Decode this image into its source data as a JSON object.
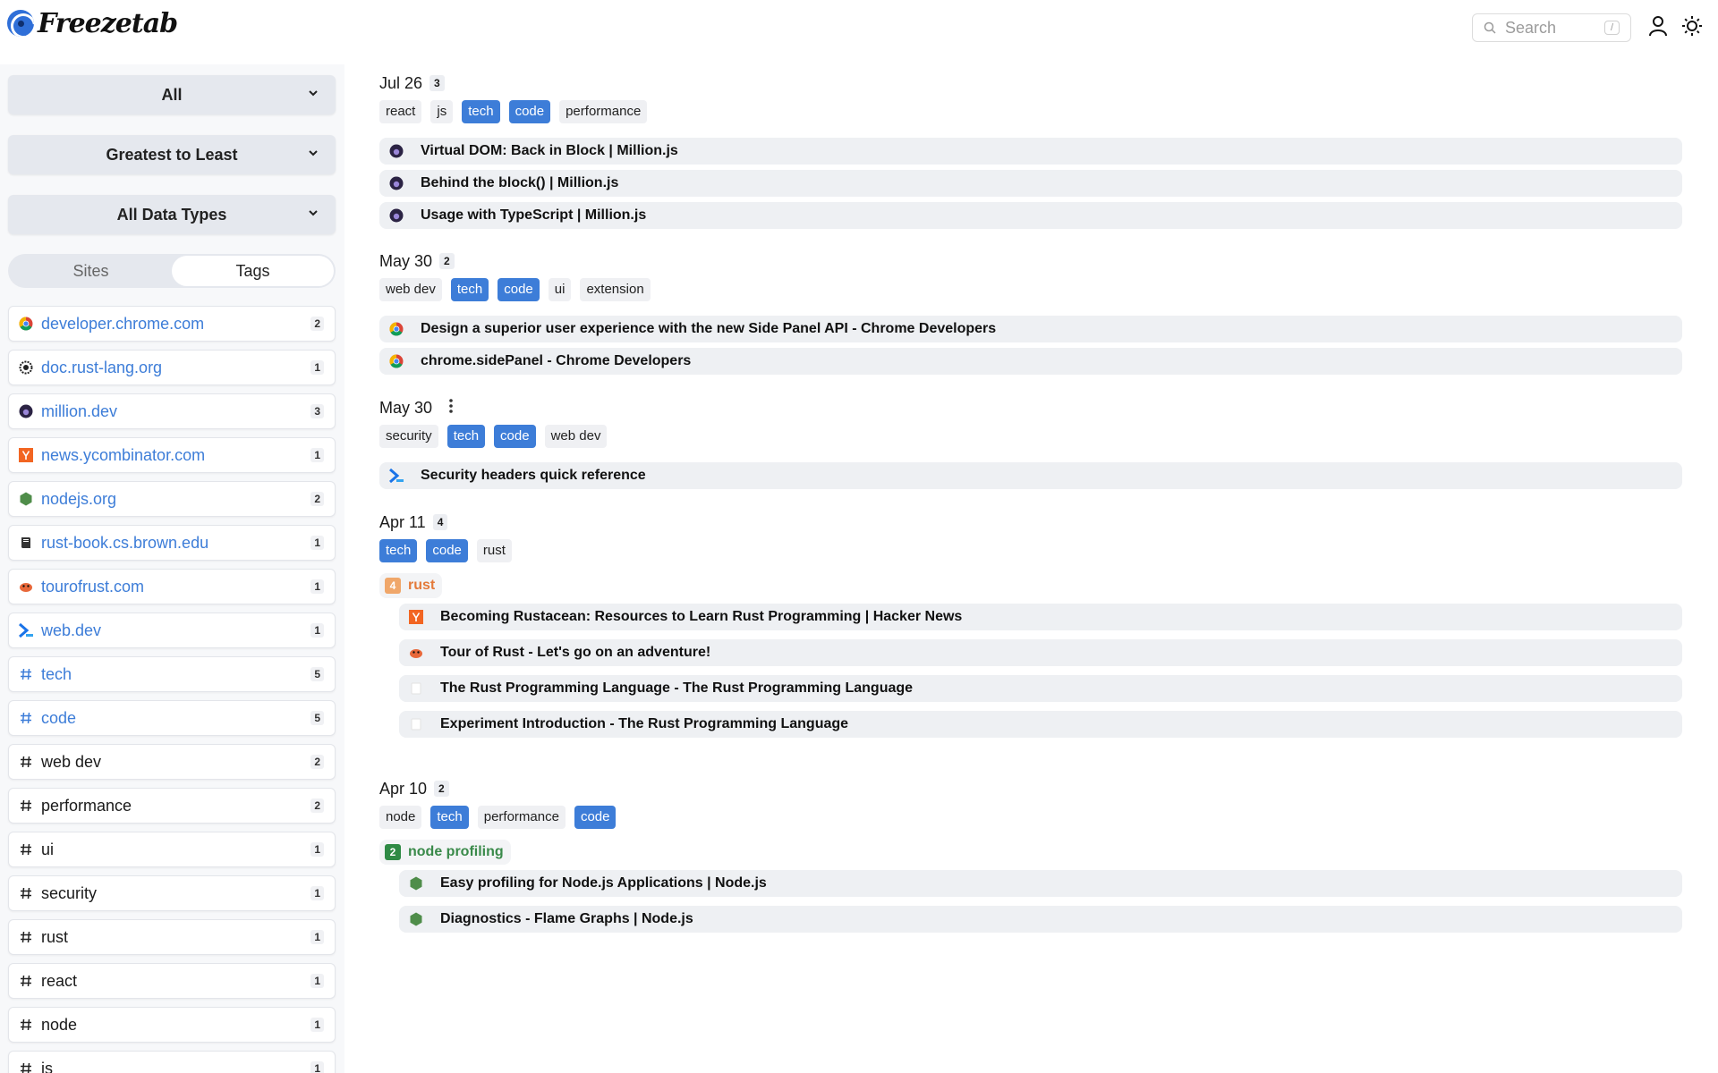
{
  "app": {
    "name": "Freezetab"
  },
  "header": {
    "search_placeholder": "Search",
    "search_shortcut": "/"
  },
  "sidebar": {
    "filter_all": "All",
    "sort_order": "Greatest to Least",
    "data_types": "All Data Types",
    "tabs": {
      "sites": "Sites",
      "tags": "Tags",
      "active": "Tags"
    },
    "items": [
      {
        "label": "developer.chrome.com",
        "count": "2",
        "icon": "chrome-icon",
        "kind": "site"
      },
      {
        "label": "doc.rust-lang.org",
        "count": "1",
        "icon": "rust-icon",
        "kind": "site"
      },
      {
        "label": "million.dev",
        "count": "3",
        "icon": "million-icon",
        "kind": "site"
      },
      {
        "label": "news.ycombinator.com",
        "count": "1",
        "icon": "ycombinator-icon",
        "kind": "site"
      },
      {
        "label": "nodejs.org",
        "count": "2",
        "icon": "nodejs-icon",
        "kind": "site"
      },
      {
        "label": "rust-book.cs.brown.edu",
        "count": "1",
        "icon": "book-icon",
        "kind": "site"
      },
      {
        "label": "tourofrust.com",
        "count": "1",
        "icon": "ferris-icon",
        "kind": "site"
      },
      {
        "label": "web.dev",
        "count": "1",
        "icon": "webdev-icon",
        "kind": "site"
      },
      {
        "label": "tech",
        "count": "5",
        "icon": "hash-icon",
        "kind": "tag-link"
      },
      {
        "label": "code",
        "count": "5",
        "icon": "hash-icon",
        "kind": "tag-link"
      },
      {
        "label": "web dev",
        "count": "2",
        "icon": "hash-icon",
        "kind": "tag"
      },
      {
        "label": "performance",
        "count": "2",
        "icon": "hash-icon",
        "kind": "tag"
      },
      {
        "label": "ui",
        "count": "1",
        "icon": "hash-icon",
        "kind": "tag"
      },
      {
        "label": "security",
        "count": "1",
        "icon": "hash-icon",
        "kind": "tag"
      },
      {
        "label": "rust",
        "count": "1",
        "icon": "hash-icon",
        "kind": "tag"
      },
      {
        "label": "react",
        "count": "1",
        "icon": "hash-icon",
        "kind": "tag"
      },
      {
        "label": "node",
        "count": "1",
        "icon": "hash-icon",
        "kind": "tag"
      },
      {
        "label": "js",
        "count": "1",
        "icon": "hash-icon",
        "kind": "tag"
      }
    ]
  },
  "groups": [
    {
      "date": "Jul 26",
      "count": "3",
      "tags": [
        {
          "t": "react",
          "hl": false
        },
        {
          "t": "js",
          "hl": false
        },
        {
          "t": "tech",
          "hl": true
        },
        {
          "t": "code",
          "hl": true
        },
        {
          "t": "performance",
          "hl": false
        }
      ],
      "tabs": [
        {
          "title": "Virtual DOM: Back in Block | Million.js",
          "icon": "million-icon"
        },
        {
          "title": "Behind the block() | Million.js",
          "icon": "million-icon"
        },
        {
          "title": "Usage with TypeScript | Million.js",
          "icon": "million-icon"
        }
      ]
    },
    {
      "date": "May 30",
      "count": "2",
      "tags": [
        {
          "t": "web dev",
          "hl": false
        },
        {
          "t": "tech",
          "hl": true
        },
        {
          "t": "code",
          "hl": true
        },
        {
          "t": "ui",
          "hl": false
        },
        {
          "t": "extension",
          "hl": false
        }
      ],
      "tabs": [
        {
          "title": "Design a superior user experience with the new Side Panel API - Chrome Developers",
          "icon": "chrome-icon"
        },
        {
          "title": "chrome.sidePanel - Chrome Developers",
          "icon": "chrome-icon"
        }
      ]
    },
    {
      "date": "May 30",
      "tags": [
        {
          "t": "security",
          "hl": false
        },
        {
          "t": "tech",
          "hl": true
        },
        {
          "t": "code",
          "hl": true
        },
        {
          "t": "web dev",
          "hl": false
        }
      ],
      "tabs": [
        {
          "title": "Security headers quick reference",
          "icon": "webdev-icon"
        }
      ]
    },
    {
      "date": "Apr 11",
      "count": "4",
      "tags": [
        {
          "t": "tech",
          "hl": true
        },
        {
          "t": "code",
          "hl": true
        },
        {
          "t": "rust",
          "hl": false
        }
      ],
      "subgroup": {
        "count": "4",
        "name": "rust",
        "color": "orange"
      },
      "tabs": [
        {
          "title": "Becoming Rustacean: Resources to Learn Rust Programming | Hacker News",
          "icon": "ycombinator-icon"
        },
        {
          "title": "Tour of Rust - Let's go on an adventure!",
          "icon": "ferris-icon"
        },
        {
          "title": "The Rust Programming Language - The Rust Programming Language",
          "icon": "blank-icon"
        },
        {
          "title": "Experiment Introduction - The Rust Programming Language",
          "icon": "blank-icon"
        }
      ]
    },
    {
      "date": "Apr 10",
      "count": "2",
      "tags": [
        {
          "t": "node",
          "hl": false
        },
        {
          "t": "tech",
          "hl": true
        },
        {
          "t": "performance",
          "hl": false
        },
        {
          "t": "code",
          "hl": true
        }
      ],
      "subgroup": {
        "count": "2",
        "name": "node profiling",
        "color": "green"
      },
      "tabs": [
        {
          "title": "Easy profiling for Node.js Applications | Node.js",
          "icon": "nodejs-icon"
        },
        {
          "title": "Diagnostics - Flame Graphs | Node.js",
          "icon": "nodejs-icon"
        }
      ]
    }
  ]
}
